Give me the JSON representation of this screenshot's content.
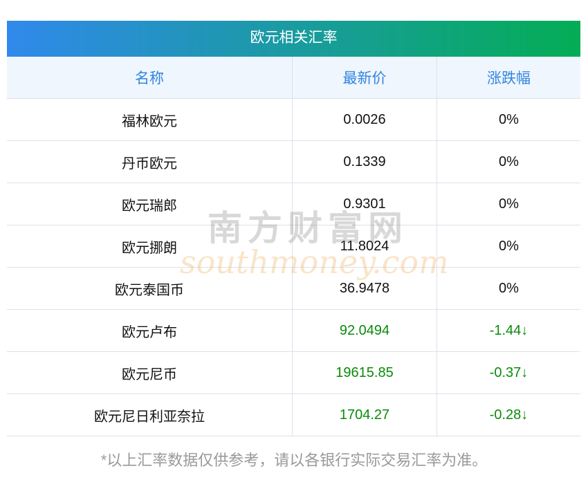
{
  "title": "欧元相关汇率",
  "headers": [
    "名称",
    "最新价",
    "涨跌幅"
  ],
  "rows": [
    {
      "name": "福林欧元",
      "price": "0.0026",
      "change": "0%",
      "down": false
    },
    {
      "name": "丹币欧元",
      "price": "0.1339",
      "change": "0%",
      "down": false
    },
    {
      "name": "欧元瑞郎",
      "price": "0.9301",
      "change": "0%",
      "down": false
    },
    {
      "name": "欧元挪朗",
      "price": "11.8024",
      "change": "0%",
      "down": false
    },
    {
      "name": "欧元泰国币",
      "price": "36.9478",
      "change": "0%",
      "down": false
    },
    {
      "name": "欧元卢布",
      "price": "92.0494",
      "change": "-1.44↓",
      "down": true
    },
    {
      "name": "欧元尼币",
      "price": "19615.85",
      "change": "-0.37↓",
      "down": true
    },
    {
      "name": "欧元尼日利亚奈拉",
      "price": "1704.27",
      "change": "-0.28↓",
      "down": true
    }
  ],
  "footer": "*以上汇率数据仅供参考，请以各银行实际交易汇率为准。",
  "watermark": {
    "cn": "南方财富网",
    "en": "southmoney.com"
  }
}
